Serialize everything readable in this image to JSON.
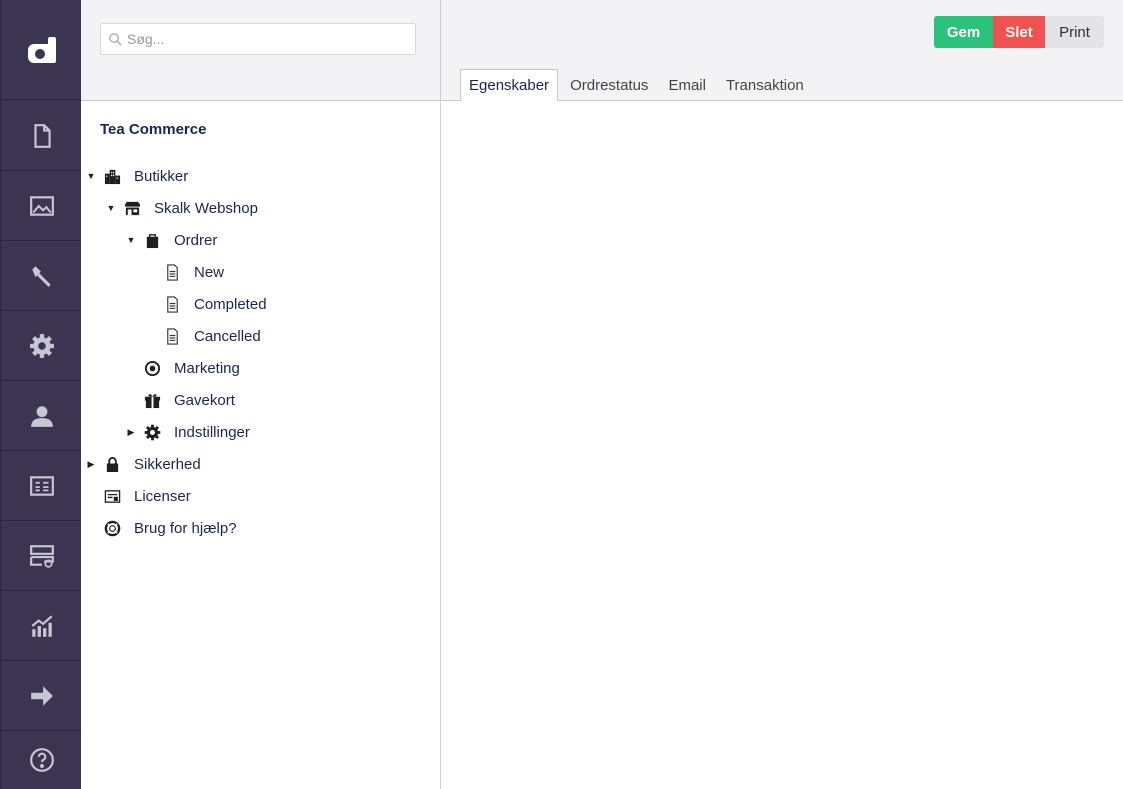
{
  "search": {
    "placeholder": "Søg..."
  },
  "tree": {
    "title": "Tea Commerce",
    "nodes": {
      "butikker": "Butikker",
      "skalk": "Skalk Webshop",
      "ordrer": "Ordrer",
      "new": "New",
      "completed": "Completed",
      "cancelled": "Cancelled",
      "marketing": "Marketing",
      "gavekort": "Gavekort",
      "indstillinger": "Indstillinger",
      "sikkerhed": "Sikkerhed",
      "licenser": "Licenser",
      "hjaelp": "Brug for hjælp?"
    }
  },
  "toolbar": {
    "save_label": "Gem",
    "delete_label": "Slet",
    "print_label": "Print"
  },
  "tabs": [
    "Egenskaber",
    "Ordrestatus",
    "Email",
    "Transaktion"
  ],
  "rail": {
    "items": [
      "document-icon",
      "image-icon",
      "wrench-icon",
      "gear-icon",
      "user-icon",
      "contact-card-icon",
      "forms-icon",
      "analytics-icon",
      "arrow-right-icon",
      "help-icon"
    ]
  },
  "colors": {
    "rail_bg": "#3b3551",
    "save": "#2bc37c",
    "delete": "#f0534f",
    "print": "#e4e4e6"
  }
}
